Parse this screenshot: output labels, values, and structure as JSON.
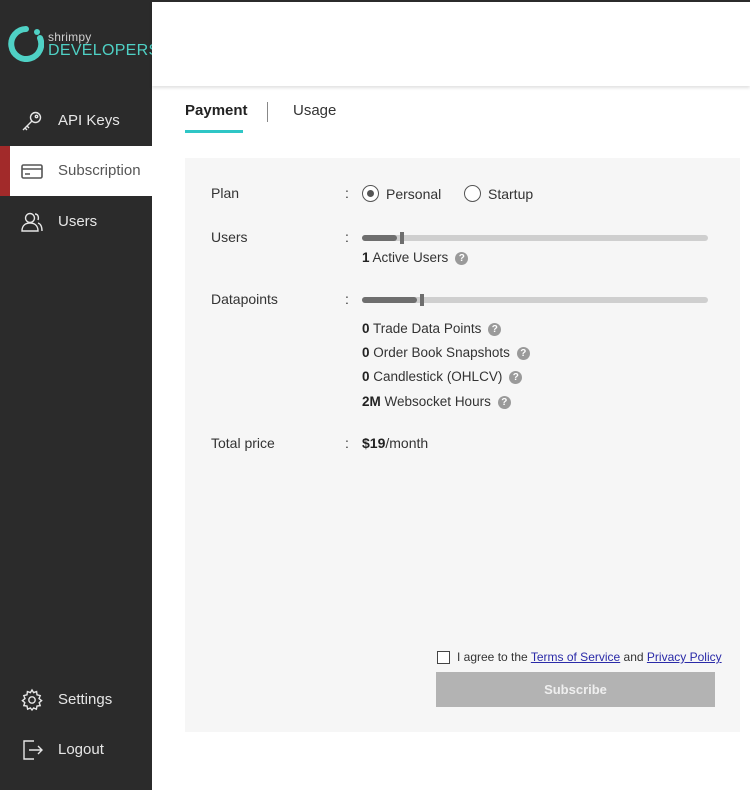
{
  "brand": {
    "small": "shrimpy",
    "big": "DEVELOPERS",
    "accent": "#4fd1c5"
  },
  "sidebar": {
    "items": [
      {
        "label": "API Keys",
        "icon": "key-icon"
      },
      {
        "label": "Subscription",
        "icon": "credit-card-icon",
        "active": true
      },
      {
        "label": "Users",
        "icon": "users-icon"
      }
    ],
    "bottom_items": [
      {
        "label": "Settings",
        "icon": "gear-icon"
      },
      {
        "label": "Logout",
        "icon": "logout-icon"
      }
    ]
  },
  "tabs": {
    "payment": "Payment",
    "usage": "Usage",
    "active": "Payment"
  },
  "plan": {
    "label": "Plan",
    "colon": ":",
    "options": [
      {
        "label": "Personal",
        "selected": true
      },
      {
        "label": "Startup",
        "selected": false
      }
    ]
  },
  "users": {
    "label": "Users",
    "slider_fraction": 0.1,
    "count": "1",
    "count_label": "Active Users"
  },
  "datapoints": {
    "label": "Datapoints",
    "slider_fraction": 0.16,
    "items": [
      {
        "value": "0",
        "label": "Trade Data Points"
      },
      {
        "value": "0",
        "label": "Order Book Snapshots"
      },
      {
        "value": "0",
        "label": "Candlestick (OHLCV)"
      },
      {
        "value": "2M",
        "label": "Websocket Hours"
      }
    ]
  },
  "total": {
    "label": "Total price",
    "amount": "$19",
    "period": "/month"
  },
  "agreement": {
    "prefix": "I agree to the",
    "terms": "Terms of Service",
    "and": "and",
    "privacy": "Privacy Policy"
  },
  "subscribe_label": "Subscribe",
  "help_glyph": "?"
}
